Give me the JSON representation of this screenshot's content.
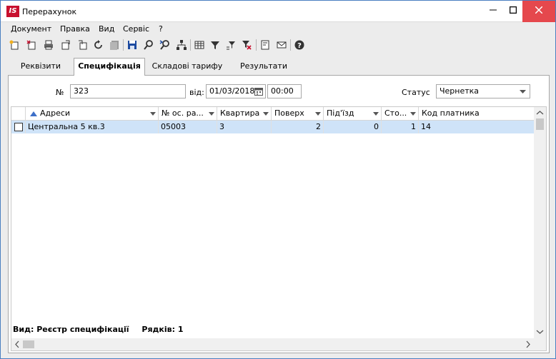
{
  "window": {
    "title": "Перерахунок",
    "logo_text": "IS"
  },
  "menu": [
    "Документ",
    "Правка",
    "Вид",
    "Сервіс",
    "?"
  ],
  "toolbar_icons": [
    "new-doc-icon",
    "copy-doc-icon",
    "print-icon",
    "export-icon",
    "import-icon",
    "refresh-icon",
    "disabled-icon",
    "save-icon",
    "search-icon",
    "find-next-icon",
    "hierarchy-icon",
    "table-icon",
    "filter-icon",
    "filter-options-icon",
    "clear-filter-icon",
    "document-icon",
    "mail-icon",
    "help-icon"
  ],
  "tabs": [
    "Реквізити",
    "Специфікація",
    "Складові тарифу",
    "Результати"
  ],
  "active_tab": "Специфікація",
  "form": {
    "number_label": "№",
    "number_value": "323",
    "date_label": "від:",
    "date_value": "01/03/2018",
    "time_value": "00:00",
    "status_label": "Статус",
    "status_value": "Чернетка"
  },
  "grid": {
    "columns": [
      "Адреси",
      "№ ос. ра...",
      "Квартира",
      "Поверх",
      "Під'їзд",
      "Сто...",
      "Код платника"
    ],
    "rows": [
      [
        "Центральна 5 кв.3",
        "05003",
        "3",
        "2",
        "0",
        "1",
        "14"
      ]
    ]
  },
  "status_bar": {
    "view": "Вид: Реєстр специфікації",
    "rows": "Рядків: 1"
  }
}
